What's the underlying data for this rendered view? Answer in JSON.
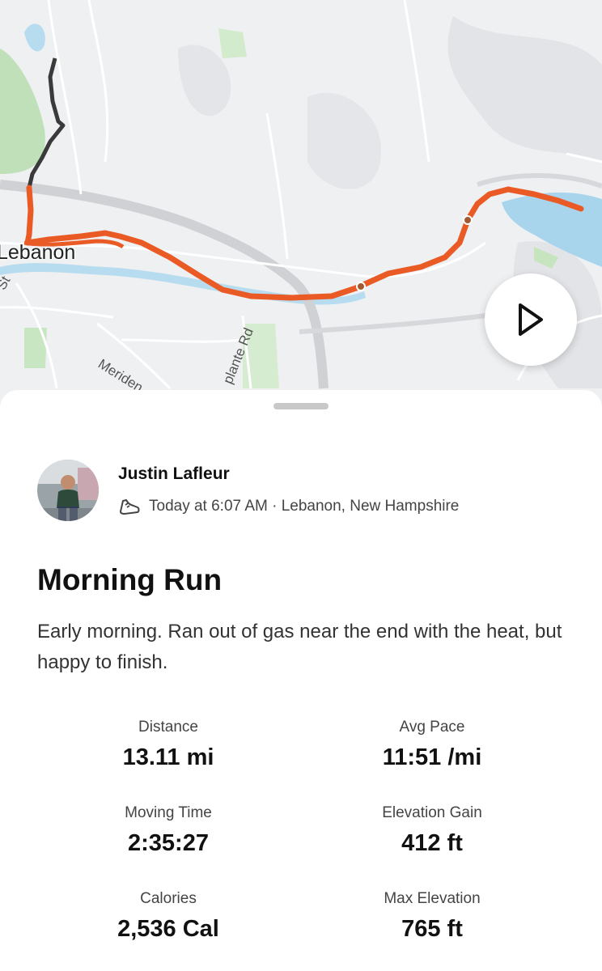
{
  "map": {
    "city_label": "Lebanon",
    "road_labels": [
      "Meriden",
      "plante Rd",
      "St"
    ],
    "route_color": "#ea5a25",
    "other_route_color": "#3a3a3a",
    "water_color": "#a8d4ec",
    "park_color": "#cfe8c8"
  },
  "play_button": {
    "icon": "play-icon"
  },
  "activity": {
    "athlete_name": "Justin Lafleur",
    "activity_icon": "shoe-icon",
    "meta": "Today at 6:07 AM · Lebanon, New Hampshire",
    "title": "Morning Run",
    "description": "Early morning. Ran out of gas near the end with the heat, but happy to finish."
  },
  "stats": [
    {
      "label": "Distance",
      "value": "13.11 mi"
    },
    {
      "label": "Avg Pace",
      "value": "11:51 /mi"
    },
    {
      "label": "Moving Time",
      "value": "2:35:27"
    },
    {
      "label": "Elevation Gain",
      "value": "412 ft"
    },
    {
      "label": "Calories",
      "value": "2,536 Cal"
    },
    {
      "label": "Max Elevation",
      "value": "765 ft"
    }
  ]
}
